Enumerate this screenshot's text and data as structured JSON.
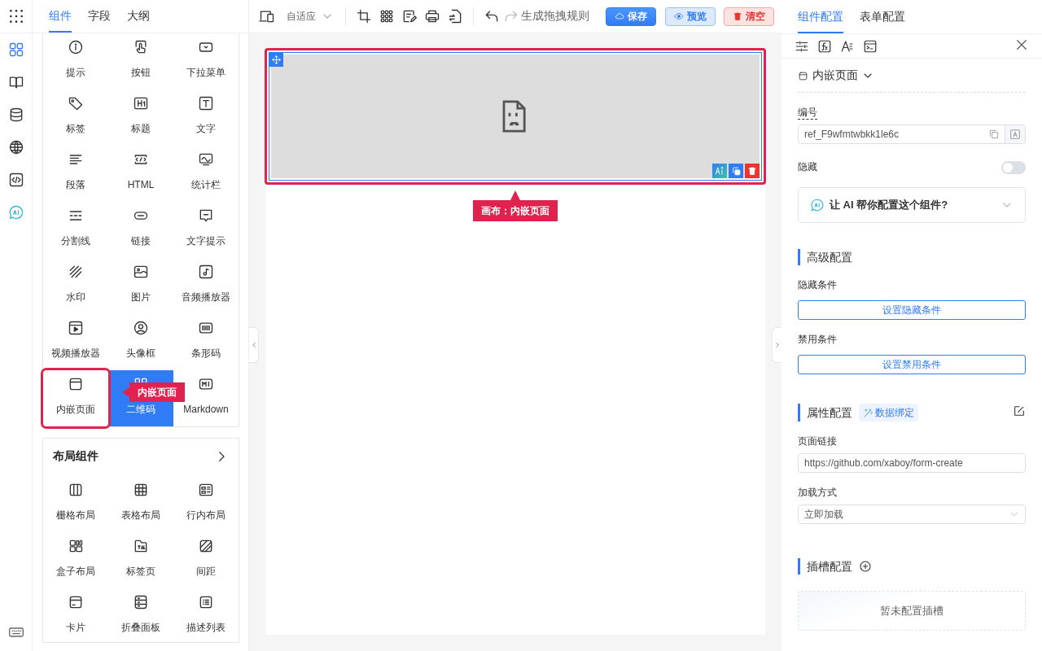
{
  "rail_items": [
    {
      "selected": true
    },
    {
      "selected": false
    },
    {
      "selected": false
    },
    {
      "selected": false
    },
    {
      "selected": false
    },
    {
      "selected": false
    }
  ],
  "left_panel": {
    "tabs": [
      {
        "label": "组件",
        "selected": true
      },
      {
        "label": "字段",
        "selected": false
      },
      {
        "label": "大纲",
        "selected": false
      }
    ],
    "basic_items": [
      {
        "label": "提示",
        "selected": false,
        "hovered": false
      },
      {
        "label": "按钮",
        "selected": false,
        "hovered": false
      },
      {
        "label": "下拉菜单",
        "selected": false,
        "hovered": false
      },
      {
        "label": "标签",
        "selected": false,
        "hovered": false
      },
      {
        "label": "标题",
        "selected": false,
        "hovered": false
      },
      {
        "label": "文字",
        "selected": false,
        "hovered": false
      },
      {
        "label": "段落",
        "selected": false,
        "hovered": false
      },
      {
        "label": "HTML",
        "selected": false,
        "hovered": false
      },
      {
        "label": "统计栏",
        "selected": false,
        "hovered": false
      },
      {
        "label": "分割线",
        "selected": false,
        "hovered": false
      },
      {
        "label": "链接",
        "selected": false,
        "hovered": false
      },
      {
        "label": "文字提示",
        "selected": false,
        "hovered": false
      },
      {
        "label": "水印",
        "selected": false,
        "hovered": false
      },
      {
        "label": "图片",
        "selected": false,
        "hovered": false
      },
      {
        "label": "音频播放器",
        "selected": false,
        "hovered": false
      },
      {
        "label": "视频播放器",
        "selected": false,
        "hovered": false
      },
      {
        "label": "头像框",
        "selected": false,
        "hovered": false
      },
      {
        "label": "条形码",
        "selected": false,
        "hovered": false
      },
      {
        "label": "内嵌页面",
        "selected": true,
        "hovered": false
      },
      {
        "label": "二维码",
        "selected": false,
        "hovered": true
      },
      {
        "label": "Markdown",
        "selected": false,
        "hovered": false
      }
    ],
    "callout": "内嵌页面",
    "layout_group": {
      "title": "布局组件",
      "items": [
        {
          "label": "栅格布局"
        },
        {
          "label": "表格布局"
        },
        {
          "label": "行内布局"
        },
        {
          "label": "盒子布局"
        },
        {
          "label": "标签页"
        },
        {
          "label": "间距"
        },
        {
          "label": "卡片"
        },
        {
          "label": "折叠面板"
        },
        {
          "label": "描述列表"
        }
      ]
    }
  },
  "toolbar": {
    "device_mode": "自适应",
    "generate_label": "生成拖拽规则",
    "buttons": [
      {
        "label": "保存",
        "kind": "primary"
      },
      {
        "label": "预览",
        "kind": "secondary"
      },
      {
        "label": "清空",
        "kind": "danger"
      }
    ]
  },
  "canvas": {
    "selected_component_callout": "画布：内嵌页面"
  },
  "right_panel": {
    "tabs": [
      {
        "label": "组件配置",
        "selected": true
      },
      {
        "label": "表单配置",
        "selected": false
      }
    ],
    "component_type": "内嵌页面",
    "ref_field": {
      "label": "编号",
      "value": "ref_F9wfmtwbkk1le6c"
    },
    "hidden_toggle": {
      "label": "隐藏",
      "on": false
    },
    "ai_prompt": "让 AI 帮你配置这个组件?",
    "advanced": {
      "title": "高级配置",
      "rows": [
        {
          "label": "隐藏条件",
          "button": "设置隐藏条件"
        },
        {
          "label": "禁用条件",
          "button": "设置禁用条件"
        }
      ]
    },
    "props": {
      "title": "属性配置",
      "binding_tag": "数据绑定",
      "fields": [
        {
          "label": "页面链接",
          "kind": "input",
          "value": "https://github.com/xaboy/form-create"
        },
        {
          "label": "加载方式",
          "kind": "select",
          "value": "立即加载"
        }
      ]
    },
    "slots": {
      "title": "插槽配置",
      "empty_text": "暂未配置插槽"
    }
  }
}
